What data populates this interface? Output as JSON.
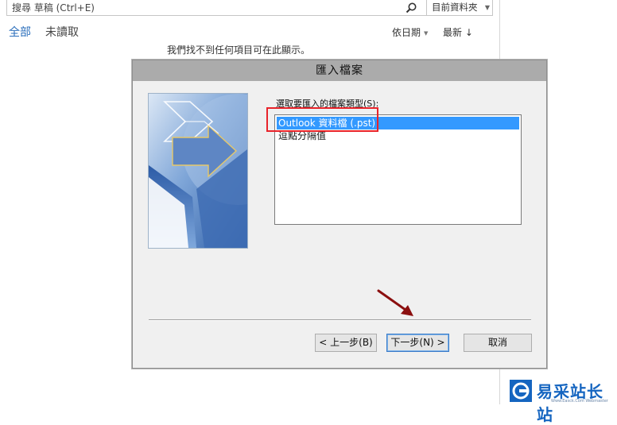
{
  "search": {
    "placeholder": "搜尋 草稿 (Ctrl+E)",
    "scope": "目前資料夾"
  },
  "filters": {
    "all": "全部",
    "unread": "未讀取"
  },
  "sort": {
    "by": "依日期",
    "order": "最新 ↓"
  },
  "message_list": {
    "empty_text": "我們找不到任何項目可在此顯示。"
  },
  "dialog": {
    "title": "匯入檔案",
    "filetype_label": "選取要匯入的檔案類型(S):",
    "filetypes": [
      {
        "label": "Outlook 資料檔 (.pst)",
        "selected": true
      },
      {
        "label": "逗點分隔值",
        "selected": false
      }
    ],
    "buttons": {
      "back": "< 上一步(B)",
      "next": "下一步(N) >",
      "cancel": "取消"
    }
  },
  "annotations": {
    "highlight_color": "#e8232a",
    "arrow_color": "#8b0f0f"
  },
  "watermark": {
    "text": "易采站长站",
    "url": "Www.Easck.Com Webmaster"
  },
  "colors": {
    "accent": "#2a6ebb",
    "selection": "#3399ff",
    "watermark": "#1565c0"
  }
}
